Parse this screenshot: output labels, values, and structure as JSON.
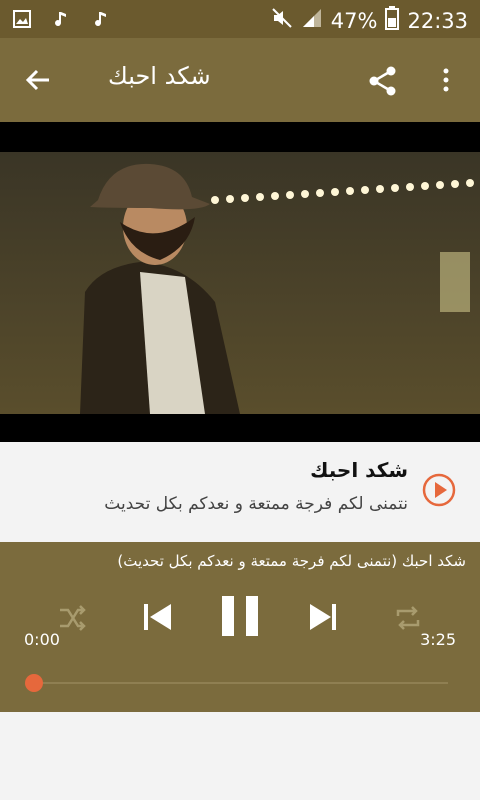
{
  "status": {
    "battery_percent": "47%",
    "time": "22:33"
  },
  "appbar": {
    "title": "شكد احبك",
    "back_icon": "arrow-left-icon",
    "share_icon": "share-icon",
    "menu_icon": "more-vert-icon"
  },
  "video": {
    "description": "video-frame"
  },
  "track": {
    "title": "شكد احبك",
    "subtitle": "نتمنى لكم فرجة ممتعة و نعدكم بكل تحديث"
  },
  "player": {
    "caption": "شكد احبك (نتمنى لكم فرجة ممتعة و نعدكم بكل تحديث)",
    "current_time": "0:00",
    "duration": "3:25",
    "progress_fraction": 0.0,
    "accent_color": "#e6683c"
  }
}
